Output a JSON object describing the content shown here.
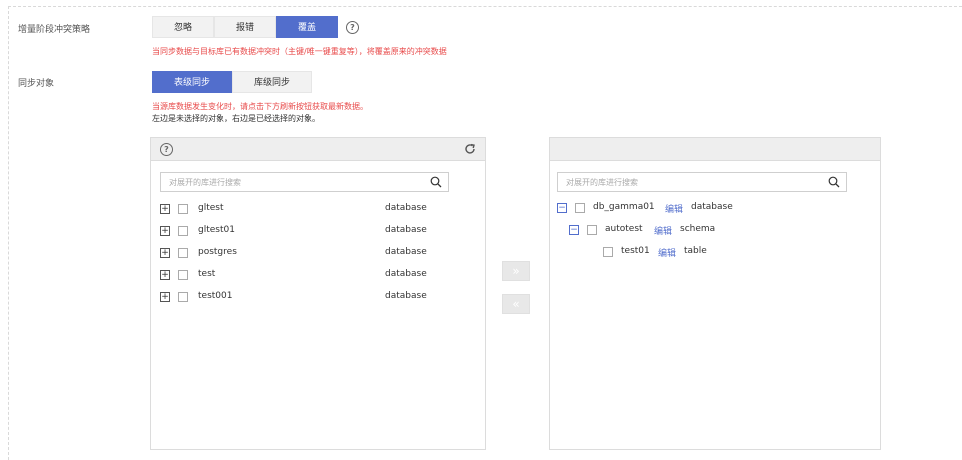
{
  "conflict": {
    "label": "增量阶段冲突策略",
    "options": [
      "忽略",
      "报错",
      "覆盖"
    ],
    "selected": "覆盖",
    "warning": "当同步数据与目标库已有数据冲突时（主键/唯一键重复等），将覆盖原来的冲突数据"
  },
  "sync": {
    "label": "同步对象",
    "options": [
      "表级同步",
      "库级同步"
    ],
    "selected": "表级同步",
    "warning": "当源库数据发生变化时，请点击下方刷新按钮获取最新数据。",
    "note": "左边是未选择的对象，右边是已经选择的对象。"
  },
  "left_panel": {
    "search_placeholder": "对展开的库进行搜索",
    "items": [
      {
        "name": "gltest",
        "type": "database"
      },
      {
        "name": "gltest01",
        "type": "database"
      },
      {
        "name": "postgres",
        "type": "database"
      },
      {
        "name": "test",
        "type": "database"
      },
      {
        "name": "test001",
        "type": "database"
      }
    ]
  },
  "right_panel": {
    "search_placeholder": "对展开的库进行搜索",
    "edit_label": "编辑",
    "tree": [
      {
        "name": "db_gamma01",
        "type": "database"
      },
      {
        "name": "autotest",
        "type": "schema"
      },
      {
        "name": "test01",
        "type": "table"
      }
    ]
  },
  "transfer": {
    "right": "»",
    "left": "«"
  }
}
